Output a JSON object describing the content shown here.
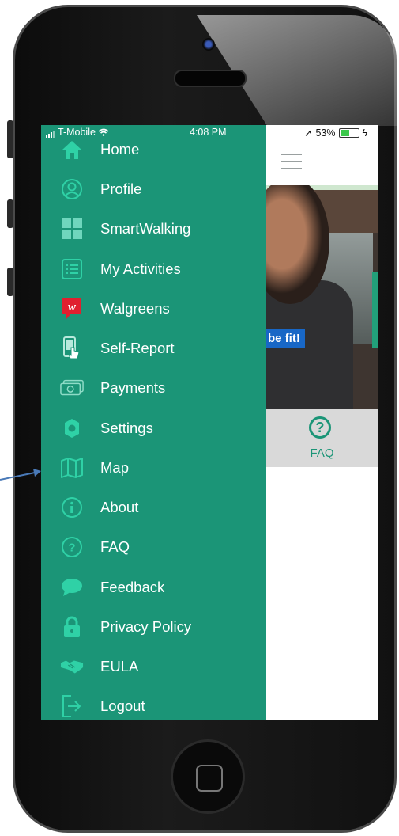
{
  "status": {
    "carrier": "T-Mobile",
    "time": "4:08 PM",
    "battery": "53%",
    "battery_level": 0.53
  },
  "menu": [
    {
      "label": "Home",
      "icon": "home-icon"
    },
    {
      "label": "Profile",
      "icon": "profile-icon"
    },
    {
      "label": "SmartWalking",
      "icon": "grid-icon"
    },
    {
      "label": "My Activities",
      "icon": "list-icon"
    },
    {
      "label": "Walgreens",
      "icon": "walgreens-icon"
    },
    {
      "label": "Self-Report",
      "icon": "phone-touch-icon"
    },
    {
      "label": "Payments",
      "icon": "money-icon"
    },
    {
      "label": "Settings",
      "icon": "gear-icon"
    },
    {
      "label": "Map",
      "icon": "map-icon"
    },
    {
      "label": "About",
      "icon": "info-icon"
    },
    {
      "label": "FAQ",
      "icon": "question-icon"
    },
    {
      "label": "Feedback",
      "icon": "chat-icon"
    },
    {
      "label": "Privacy Policy",
      "icon": "lock-icon"
    },
    {
      "label": "EULA",
      "icon": "handshake-icon"
    },
    {
      "label": "Logout",
      "icon": "logout-icon"
    }
  ],
  "banner": {
    "text": "be fit!"
  },
  "faq_button": {
    "glyph": "?",
    "label": "FAQ"
  },
  "colors": {
    "drawer": "#1b9577",
    "icon": "#2fd1a6",
    "accent": "#1b9577",
    "arrow": "#4a7ab8"
  }
}
